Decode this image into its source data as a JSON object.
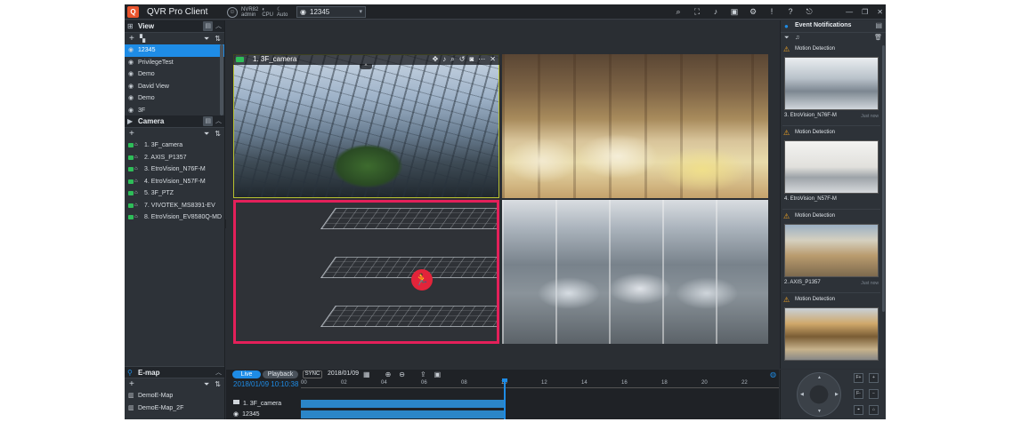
{
  "app": {
    "title": "QVR Pro Client",
    "logo_letter": "Q"
  },
  "header": {
    "nvr_name": "NVR82",
    "user": "admin",
    "cpu_label": "CPU",
    "mode_label": "Auto",
    "view_selector": "12345",
    "toolbar_icons": [
      "search-icon",
      "fullscreen-icon",
      "volume-icon",
      "clip-icon",
      "settings-icon",
      "alert-icon",
      "help-icon",
      "logout-icon"
    ]
  },
  "left": {
    "view": {
      "title": "View",
      "items": [
        {
          "label": "12345",
          "selected": true
        },
        {
          "label": "PrivilegeTest"
        },
        {
          "label": "Demo"
        },
        {
          "label": "David View"
        },
        {
          "label": "Demo"
        },
        {
          "label": "3F"
        }
      ]
    },
    "camera": {
      "title": "Camera",
      "items": [
        "1. 3F_camera",
        "2. AXIS_P1357",
        "3. EtroVision_N76F-M",
        "4. EtroVision_N57F-M",
        "5. 3F_PTZ",
        "7. VIVOTEK_MS8391-EV",
        "8. EtroVision_EV8580Q-MD"
      ]
    },
    "emap": {
      "title": "E-map",
      "items": [
        "DemoE-Map",
        "DemoE-Map_2F"
      ]
    }
  },
  "center": {
    "active_camera": "1. 3F_camera",
    "tiles": [
      "atrium-camera",
      "restaurant-camera",
      "emap-floorplan",
      "parking-camera"
    ]
  },
  "right": {
    "title": "Event Notifications",
    "events": [
      {
        "type": "Motion Detection",
        "camera": "3. EtroVision_N76F-M",
        "time": "Just now"
      },
      {
        "type": "Motion Detection",
        "camera": "4. EtroVision_N57F-M",
        "time": ""
      },
      {
        "type": "Motion Detection",
        "camera": "2. AXIS_P1357",
        "time": "Just now"
      },
      {
        "type": "Motion Detection",
        "camera": "",
        "time": ""
      }
    ]
  },
  "playback": {
    "live_label": "Live",
    "playback_label": "Playback",
    "sync_label": "SYNC",
    "date": "2018/01/09",
    "timestamp": "2018/01/09 10:10:38",
    "ticks": [
      "00",
      "02",
      "04",
      "06",
      "08",
      "10",
      "12",
      "14",
      "16",
      "18",
      "20",
      "22"
    ],
    "tracks": [
      {
        "label": "1. 3F_camera"
      },
      {
        "label": "12345"
      }
    ]
  },
  "ptz": {
    "buttons": [
      "F+",
      "F-",
      "zoom-in-icon",
      "zoom-out-icon",
      "preset-icon",
      "home-icon"
    ]
  },
  "colors": {
    "accent": "#1e8ce6",
    "alert": "#e4205a",
    "warning": "#f5a623",
    "online": "#2ebd59"
  }
}
